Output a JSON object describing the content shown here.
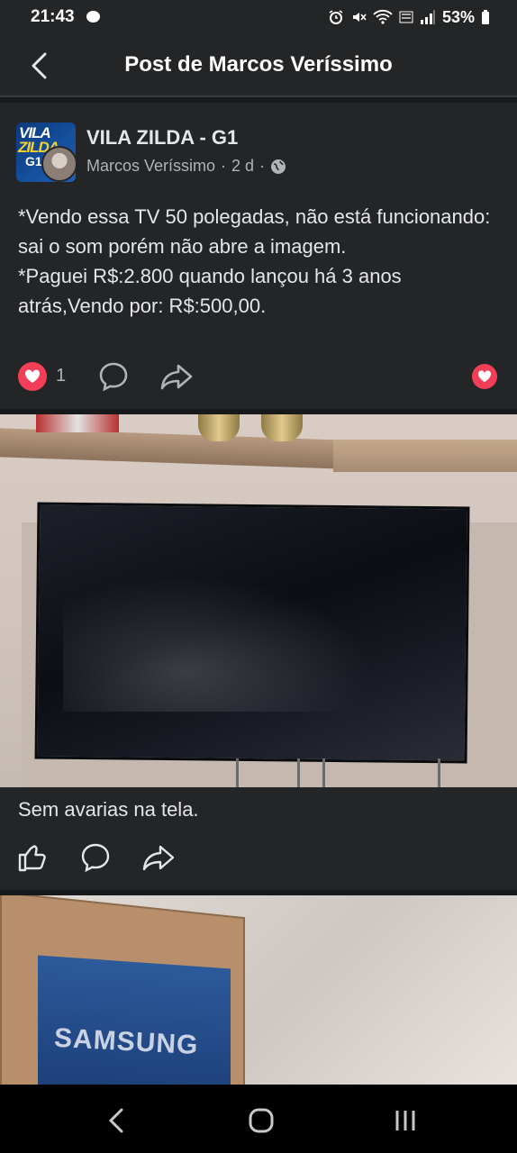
{
  "status": {
    "time": "21:43",
    "battery": "53%",
    "icons": [
      "chat-icon",
      "alarm-icon",
      "mute-icon",
      "wifi-icon",
      "volte-icon",
      "signal-icon",
      "battery-icon"
    ]
  },
  "header": {
    "title": "Post de Marcos Veríssimo",
    "back_icon": "back-arrow-icon"
  },
  "post": {
    "group_name": "VILA ZILDA - G1",
    "group_avatar_text": [
      "VILA",
      "ZILDA",
      "G1"
    ],
    "author": "Marcos Veríssimo",
    "time": "2 d",
    "separator": "·",
    "privacy_icon": "globe-icon",
    "text": "*Vendo essa TV 50 polegadas, não está funcionando: sai o som porém não abre a imagem.\n*Paguei R$:2.800 quando lançou há 3 anos atrás,Vendo por: R$:500,00.",
    "reaction_count": "1",
    "colors": {
      "reaction": "#f33e58",
      "card": "#242526",
      "background": "#18191a"
    }
  },
  "photo_1": {
    "subject": "television-on-wall"
  },
  "photo_1_card": {
    "caption": "Sem avarias na tela."
  },
  "photo_2": {
    "brand_text": "SAMSUNG"
  },
  "navbar": {
    "icons": [
      "nav-back-icon",
      "nav-home-icon",
      "nav-recent-apps-icon"
    ]
  }
}
